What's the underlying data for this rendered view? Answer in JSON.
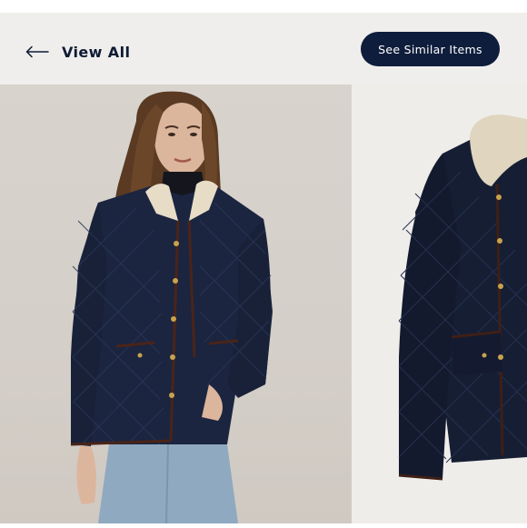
{
  "nav": {
    "back_label": "View All",
    "back_icon": "arrow-left-icon",
    "similar_label": "See Similar Items"
  },
  "colors": {
    "header_bg": "#efeeec",
    "accent_navy": "#0e1d3b",
    "jacket_navy": "#1b2540",
    "collar_cream": "#e7dcc6",
    "trim_brown": "#4a2418"
  }
}
